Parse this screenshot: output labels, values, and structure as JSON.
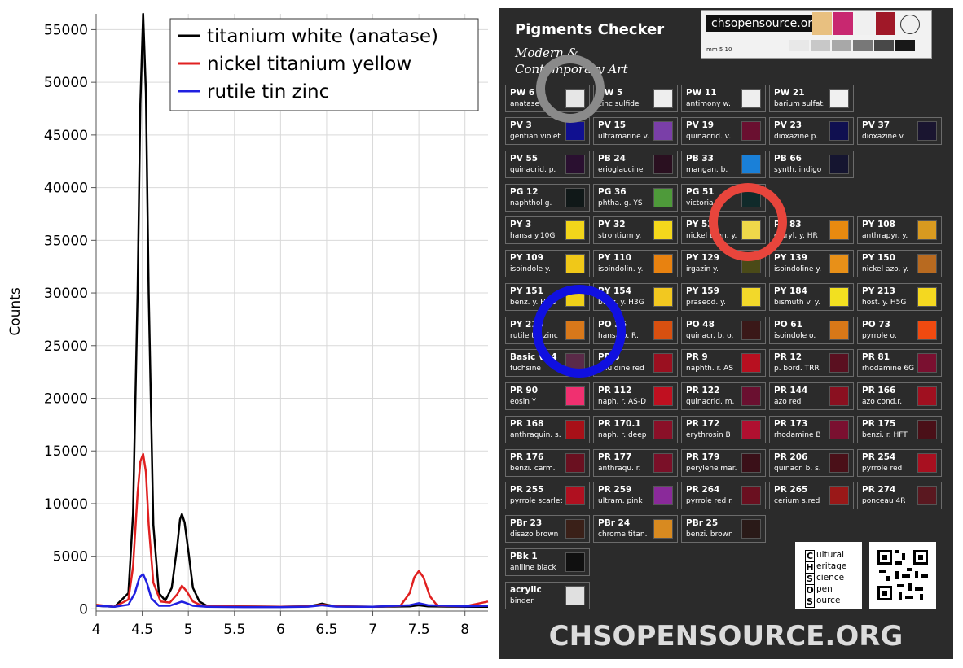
{
  "chart_data": {
    "type": "line",
    "title": "",
    "xlabel": "",
    "ylabel": "Counts",
    "xlim": [
      4.0,
      8.25
    ],
    "ylim": [
      -200,
      56500
    ],
    "xticks": [
      4,
      4.5,
      5,
      5.5,
      6,
      6.5,
      7,
      7.5,
      8
    ],
    "xtick_labels": [
      "4",
      "4.5",
      "5",
      "5.5",
      "6",
      "6.5",
      "7",
      "7.5",
      "8"
    ],
    "yticks": [
      0,
      5000,
      10000,
      15000,
      20000,
      25000,
      30000,
      35000,
      40000,
      45000,
      50000,
      55000
    ],
    "ytick_labels": [
      "0",
      "5000",
      "10000",
      "15000",
      "20000",
      "25000",
      "30000",
      "35000",
      "40000",
      "45000",
      "50000",
      "55000"
    ],
    "grid": true,
    "legend_position": "top-right",
    "series": [
      {
        "name": "titanium white (anatase)",
        "color": "#000000",
        "x": [
          4.0,
          4.2,
          4.35,
          4.4,
          4.45,
          4.48,
          4.51,
          4.54,
          4.57,
          4.62,
          4.68,
          4.75,
          4.82,
          4.88,
          4.91,
          4.93,
          4.96,
          5.0,
          5.05,
          5.12,
          5.2,
          5.4,
          6.0,
          6.3,
          6.4,
          6.45,
          6.5,
          6.6,
          7.0,
          7.4,
          7.5,
          7.6,
          8.0,
          8.25
        ],
        "y": [
          300,
          200,
          1500,
          9000,
          30000,
          48000,
          56500,
          49000,
          30000,
          8000,
          1500,
          800,
          2000,
          6000,
          8500,
          9000,
          8200,
          5500,
          2000,
          700,
          300,
          250,
          200,
          250,
          400,
          500,
          400,
          250,
          200,
          250,
          350,
          250,
          200,
          200
        ]
      },
      {
        "name": "nickel titanium yellow",
        "color": "#e02020",
        "x": [
          4.0,
          4.2,
          4.35,
          4.4,
          4.45,
          4.48,
          4.51,
          4.54,
          4.57,
          4.62,
          4.7,
          4.8,
          4.88,
          4.93,
          4.98,
          5.05,
          5.15,
          5.4,
          6.0,
          6.3,
          6.4,
          6.45,
          6.5,
          6.6,
          7.0,
          7.3,
          7.4,
          7.45,
          7.5,
          7.55,
          7.62,
          7.7,
          8.0,
          8.25
        ],
        "y": [
          400,
          200,
          900,
          4000,
          11000,
          14000,
          14700,
          13000,
          8000,
          2500,
          700,
          600,
          1400,
          2200,
          1700,
          700,
          300,
          250,
          200,
          250,
          350,
          400,
          350,
          250,
          200,
          300,
          1500,
          3000,
          3600,
          3000,
          1200,
          300,
          250,
          700
        ]
      },
      {
        "name": "rutile tin zinc",
        "color": "#2020e0",
        "x": [
          4.0,
          4.2,
          4.35,
          4.42,
          4.47,
          4.51,
          4.55,
          4.6,
          4.68,
          4.8,
          4.88,
          4.93,
          4.98,
          5.05,
          5.2,
          5.6,
          6.0,
          6.3,
          6.4,
          6.45,
          6.5,
          6.6,
          7.0,
          7.4,
          7.5,
          7.6,
          8.0,
          8.25
        ],
        "y": [
          300,
          200,
          400,
          1500,
          3000,
          3300,
          2500,
          1000,
          300,
          300,
          550,
          700,
          550,
          300,
          200,
          180,
          180,
          220,
          300,
          350,
          300,
          220,
          200,
          350,
          550,
          350,
          250,
          300
        ]
      }
    ]
  },
  "checker": {
    "title": "Pigments Checker",
    "subtitle_line1": "Modern &",
    "subtitle_line2": "Contemporary Art",
    "scale_logo": "chsopensource.org",
    "scale_mm": "mm 5   10",
    "logo_letters": [
      "C",
      "H",
      "S",
      "O",
      "S"
    ],
    "logo_words": [
      "ultural",
      "eritage",
      "cience",
      "pen",
      "ource"
    ],
    "footer": "CHSOPENSOURCE.ORG",
    "cells": [
      {
        "code": "PW 6",
        "name": "anatase",
        "color": "#e6e6e6",
        "col": 0,
        "row": 0
      },
      {
        "code": "PW 5",
        "name": "zinc sulfide",
        "color": "#eeeeee",
        "col": 1,
        "row": 0
      },
      {
        "code": "PW 11",
        "name": "antimony w.",
        "color": "#eeeeee",
        "col": 2,
        "row": 0
      },
      {
        "code": "PW 21",
        "name": "barium sulfat.",
        "color": "#f0f0f0",
        "col": 3,
        "row": 0
      },
      {
        "code": "PV 3",
        "name": "gentian violet",
        "color": "#101090",
        "col": 0,
        "row": 1
      },
      {
        "code": "PV 15",
        "name": "ultramarine v.",
        "color": "#7a3fa8",
        "col": 1,
        "row": 1
      },
      {
        "code": "PV 19",
        "name": "quinacrid. v.",
        "color": "#6a1030",
        "col": 2,
        "row": 1
      },
      {
        "code": "PV 23",
        "name": "dioxazine p.",
        "color": "#101050",
        "col": 3,
        "row": 1
      },
      {
        "code": "PV 37",
        "name": "dioxazine v.",
        "color": "#1a1530",
        "col": 4,
        "row": 1
      },
      {
        "code": "PV 55",
        "name": "quinacrid. p.",
        "color": "#2a1030",
        "col": 0,
        "row": 2
      },
      {
        "code": "PB 24",
        "name": "erioglaucine",
        "color": "#2a1020",
        "col": 1,
        "row": 2
      },
      {
        "code": "PB 33",
        "name": "mangan. b.",
        "color": "#1a80d8",
        "col": 2,
        "row": 2
      },
      {
        "code": "PB 66",
        "name": "synth. indigo",
        "color": "#151530",
        "col": 3,
        "row": 2
      },
      {
        "code": "PG 12",
        "name": "naphthol g.",
        "color": "#101818",
        "col": 0,
        "row": 3
      },
      {
        "code": "PG 36",
        "name": "phtha. g. YS",
        "color": "#4e9a3a",
        "col": 1,
        "row": 3
      },
      {
        "code": "PG 51",
        "name": "victoria g.",
        "color": "#102a2a",
        "col": 2,
        "row": 3
      },
      {
        "code": "PY 3",
        "name": "hansa y.10G",
        "color": "#f2d51a",
        "col": 0,
        "row": 4
      },
      {
        "code": "PY 32",
        "name": "strontium y.",
        "color": "#f4d81c",
        "col": 1,
        "row": 4
      },
      {
        "code": "PY 53",
        "name": "nickel titan. y.",
        "color": "#efd84a",
        "col": 2,
        "row": 4
      },
      {
        "code": "PY 83",
        "name": "diaryl. y. HR",
        "color": "#e88a10",
        "col": 3,
        "row": 4
      },
      {
        "code": "PY 108",
        "name": "anthrapyr. y.",
        "color": "#d89a20",
        "col": 4,
        "row": 4
      },
      {
        "code": "PY 109",
        "name": "isoindole y.",
        "color": "#f0c818",
        "col": 0,
        "row": 5
      },
      {
        "code": "PY 110",
        "name": "isoindolin. y.",
        "color": "#e88210",
        "col": 1,
        "row": 5
      },
      {
        "code": "PY 129",
        "name": "irgazin y.",
        "color": "#4a4a18",
        "col": 2,
        "row": 5
      },
      {
        "code": "PY 139",
        "name": "isoindoline y.",
        "color": "#e89018",
        "col": 3,
        "row": 5
      },
      {
        "code": "PY 150",
        "name": "nickel azo. y.",
        "color": "#b86a20",
        "col": 4,
        "row": 5
      },
      {
        "code": "PY 151",
        "name": "benz. y. H4G",
        "color": "#f0d018",
        "col": 0,
        "row": 6
      },
      {
        "code": "PY 154",
        "name": "benz. y. H3G",
        "color": "#f2c820",
        "col": 1,
        "row": 6
      },
      {
        "code": "PY 159",
        "name": "praseod. y.",
        "color": "#f2d82a",
        "col": 2,
        "row": 6
      },
      {
        "code": "PY 184",
        "name": "bismuth v. y.",
        "color": "#f2e020",
        "col": 3,
        "row": 6
      },
      {
        "code": "PY 213",
        "name": "host. y. H5G",
        "color": "#f4d820",
        "col": 4,
        "row": 6
      },
      {
        "code": "PY 216",
        "name": "rutile tin zinc",
        "color": "#d8781a",
        "col": 0,
        "row": 7
      },
      {
        "code": "PO 36",
        "name": "hansa o. R.",
        "color": "#d85010",
        "col": 1,
        "row": 7
      },
      {
        "code": "PO 48",
        "name": "quinacr. b. o.",
        "color": "#3a1818",
        "col": 2,
        "row": 7
      },
      {
        "code": "PO 61",
        "name": "isoindole o.",
        "color": "#d87818",
        "col": 3,
        "row": 7
      },
      {
        "code": "PO 73",
        "name": "pyrrole o.",
        "color": "#f04a10",
        "col": 4,
        "row": 7
      },
      {
        "code": "Basic V14",
        "name": "fuchsine",
        "color": "#5a2a48",
        "col": 0,
        "row": 8
      },
      {
        "code": "PR 3",
        "name": "toluidine red",
        "color": "#9a1020",
        "col": 1,
        "row": 8
      },
      {
        "code": "PR 9",
        "name": "naphth. r. AS",
        "color": "#b81020",
        "col": 2,
        "row": 8
      },
      {
        "code": "PR 12",
        "name": "p. bord. TRR",
        "color": "#5a1020",
        "col": 3,
        "row": 8
      },
      {
        "code": "PR 81",
        "name": "rhodamine 6G",
        "color": "#7a1030",
        "col": 4,
        "row": 8
      },
      {
        "code": "PR 90",
        "name": "eosin Y",
        "color": "#f03070",
        "col": 0,
        "row": 9
      },
      {
        "code": "PR 112",
        "name": "naph. r. AS-D",
        "color": "#c01020",
        "col": 1,
        "row": 9
      },
      {
        "code": "PR 122",
        "name": "quinacrid. m.",
        "color": "#6a1030",
        "col": 2,
        "row": 9
      },
      {
        "code": "PR 144",
        "name": "azo red",
        "color": "#8a1020",
        "col": 3,
        "row": 9
      },
      {
        "code": "PR 166",
        "name": "azo cond.r.",
        "color": "#a01020",
        "col": 4,
        "row": 9
      },
      {
        "code": "PR 168",
        "name": "anthraquin. s.",
        "color": "#a81018",
        "col": 0,
        "row": 10
      },
      {
        "code": "PR 170.1",
        "name": "naph. r. deep",
        "color": "#8a1028",
        "col": 1,
        "row": 10
      },
      {
        "code": "PR 172",
        "name": "erythrosin B",
        "color": "#b01030",
        "col": 2,
        "row": 10
      },
      {
        "code": "PR 173",
        "name": "rhodamine B",
        "color": "#7a1030",
        "col": 3,
        "row": 10
      },
      {
        "code": "PR 175",
        "name": "benzi. r. HFT",
        "color": "#4a1018",
        "col": 4,
        "row": 10
      },
      {
        "code": "PR 176",
        "name": "benzi. carm.",
        "color": "#6a1020",
        "col": 0,
        "row": 11
      },
      {
        "code": "PR 177",
        "name": "anthraqu. r.",
        "color": "#7a1028",
        "col": 1,
        "row": 11
      },
      {
        "code": "PR 179",
        "name": "perylene mar.",
        "color": "#3a1018",
        "col": 2,
        "row": 11
      },
      {
        "code": "PR 206",
        "name": "quinacr. b. s.",
        "color": "#4a1018",
        "col": 3,
        "row": 11
      },
      {
        "code": "PR 254",
        "name": "pyrrole red",
        "color": "#a81020",
        "col": 4,
        "row": 11
      },
      {
        "code": "PR 255",
        "name": "pyrrole scarlet",
        "color": "#b01020",
        "col": 0,
        "row": 12
      },
      {
        "code": "PR 259",
        "name": "ultram. pink",
        "color": "#8a2a9a",
        "col": 1,
        "row": 12
      },
      {
        "code": "PR 264",
        "name": "pyrrole red r.",
        "color": "#6a1020",
        "col": 2,
        "row": 12
      },
      {
        "code": "PR 265",
        "name": "cerium s.red",
        "color": "#9a1818",
        "col": 3,
        "row": 12
      },
      {
        "code": "PR 274",
        "name": "ponceau 4R",
        "color": "#5a1820",
        "col": 4,
        "row": 12
      },
      {
        "code": "PBr 23",
        "name": "disazo brown",
        "color": "#3a2018",
        "col": 0,
        "row": 13
      },
      {
        "code": "PBr 24",
        "name": "chrome titan.",
        "color": "#d88a20",
        "col": 1,
        "row": 13
      },
      {
        "code": "PBr 25",
        "name": "benzi. brown",
        "color": "#2a1a18",
        "col": 2,
        "row": 13
      },
      {
        "code": "PBk 1",
        "name": "aniline black",
        "color": "#101010",
        "col": 0,
        "row": 14
      },
      {
        "code": "acrylic",
        "name": "binder",
        "color": "#e0e0e0",
        "col": 0,
        "row": 15
      }
    ],
    "circles": [
      {
        "name": "gray",
        "color": "#8a8a8a"
      },
      {
        "name": "red",
        "color": "#e8453c"
      },
      {
        "name": "blue",
        "color": "#1010e0"
      }
    ]
  }
}
